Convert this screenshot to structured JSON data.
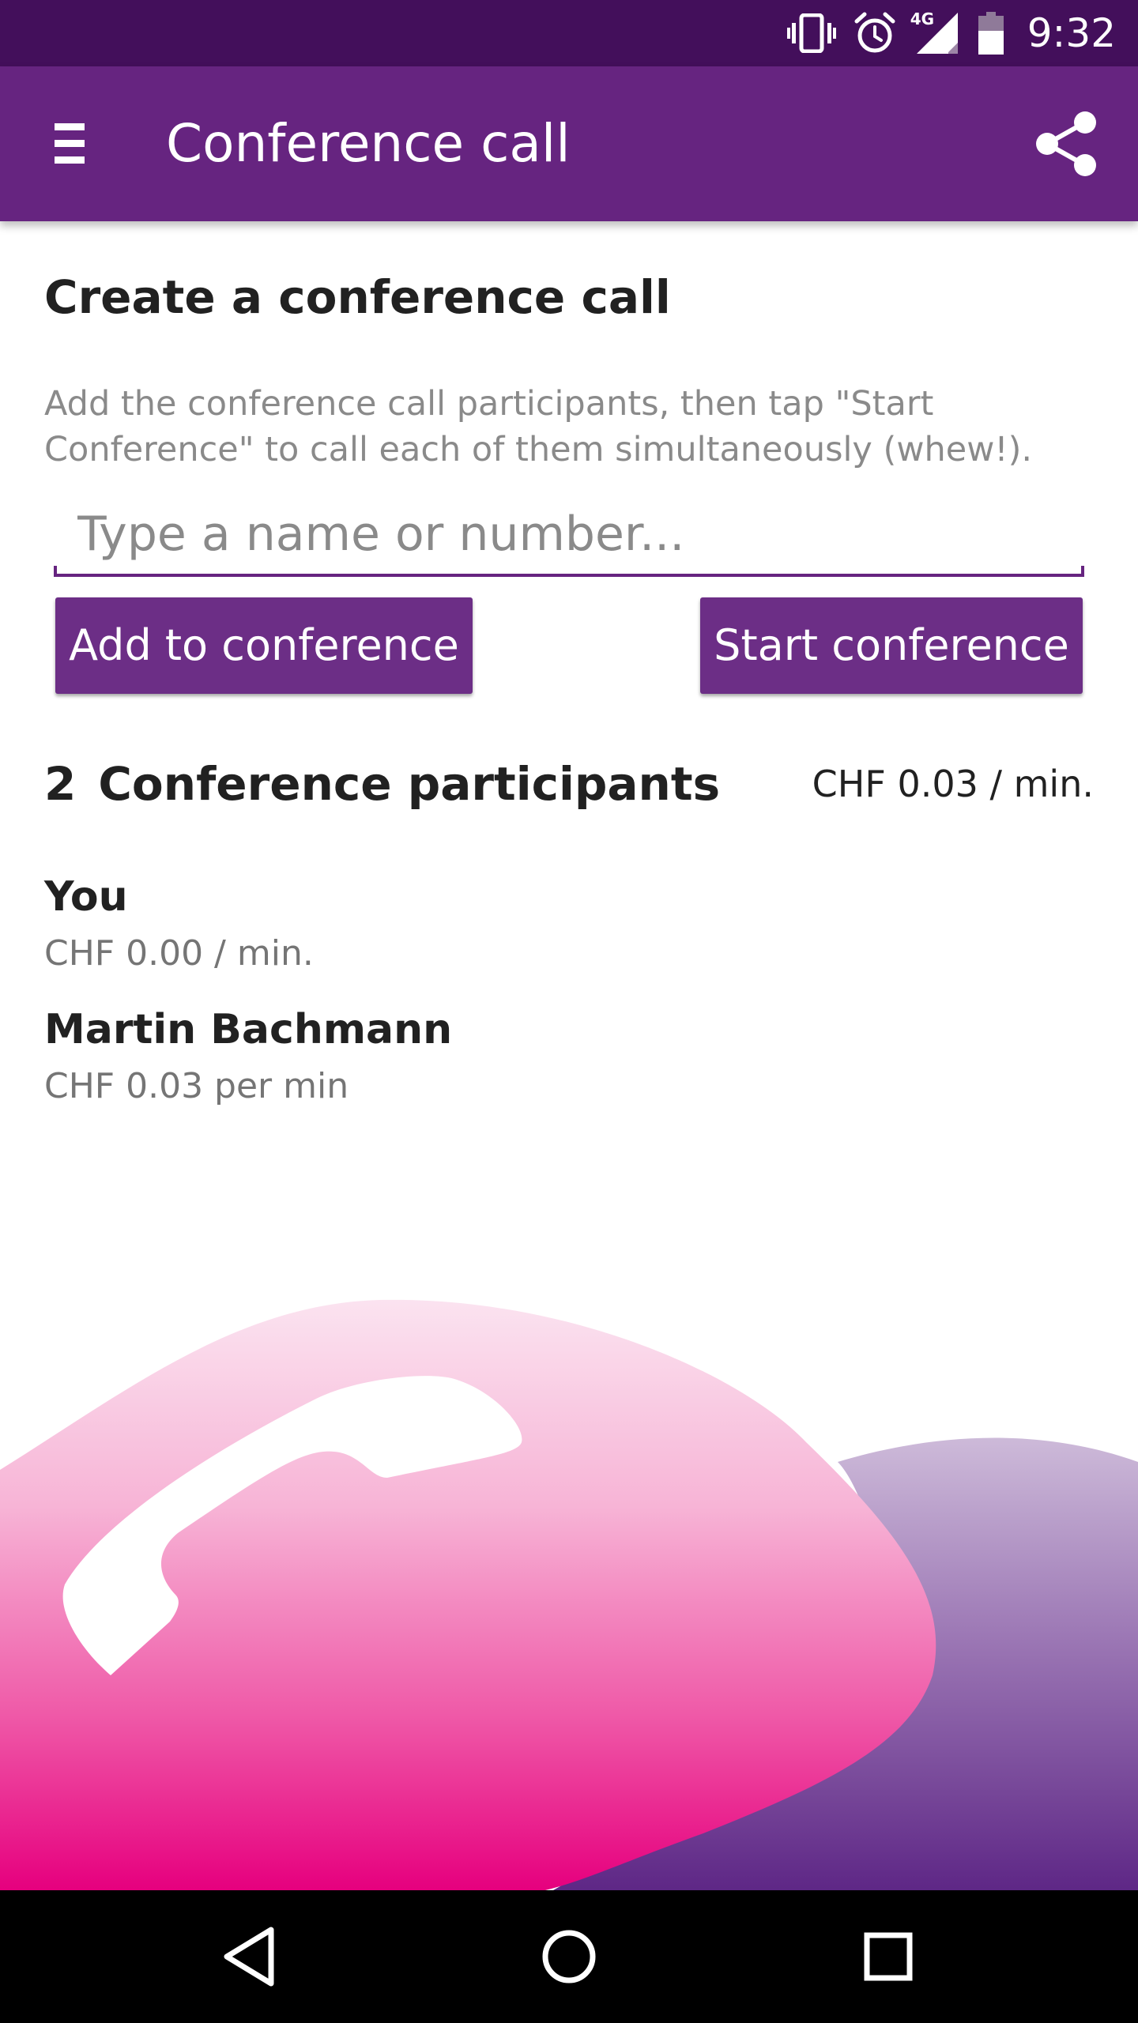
{
  "status_bar": {
    "time": "9:32",
    "network": "4G",
    "icons": [
      "vibrate-icon",
      "alarm-icon",
      "signal-icon",
      "battery-icon"
    ]
  },
  "app_bar": {
    "title": "Conference call",
    "menu_icon": "hamburger-menu-icon",
    "share_icon": "share-icon"
  },
  "create": {
    "title": "Create a conference call",
    "description": "Add the conference call participants, then tap \"Start Conference\" to call each of them simultaneously (whew!).",
    "input_placeholder": "Type a name or number...",
    "input_value": "",
    "add_button": "Add to conference",
    "start_button": "Start conference"
  },
  "participants": {
    "count": "2",
    "title": "Conference participants",
    "rate": "CHF 0.03 / min.",
    "items": [
      {
        "name": "You",
        "rate": "CHF 0.00 / min."
      },
      {
        "name": "Martin Bachmann",
        "rate": "CHF 0.03 per min"
      }
    ]
  },
  "illustration": {
    "icon": "phone-handset-icon"
  },
  "nav_bar": {
    "icons": [
      "back-icon",
      "home-icon",
      "recents-icon"
    ]
  },
  "colors": {
    "status_bar": "#430f5b",
    "app_bar": "#662480",
    "button": "#6c2e86",
    "accent_pink": "#e6007e",
    "text_dark": "#212121",
    "text_muted": "#8a8a8a"
  }
}
